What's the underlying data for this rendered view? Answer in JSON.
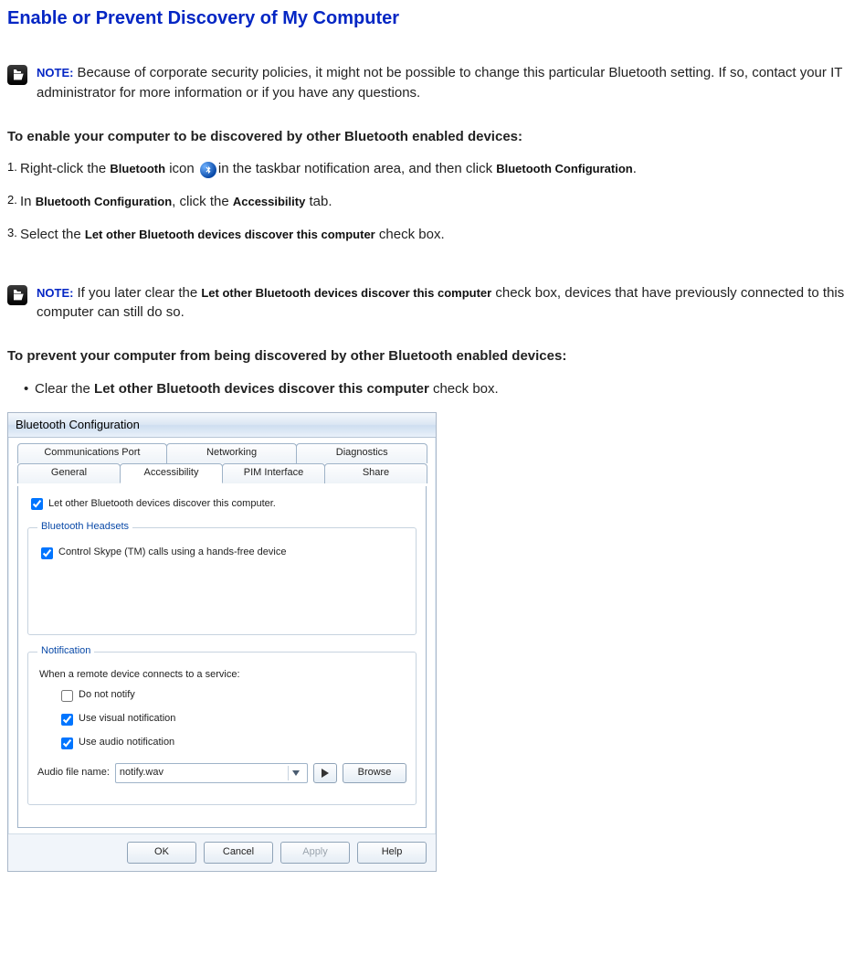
{
  "title": "Enable or Prevent Discovery of My Computer",
  "notes": {
    "label": "NOTE:",
    "note1": "Because of corporate security policies, it might not be possible to change this particular Bluetooth setting. If so, contact your IT administrator for more information or if you have any questions.",
    "note2_pre": "If you later clear the ",
    "note2_mid": "Let other Bluetooth devices discover this computer",
    "note2_post": " check box, devices that have previously connected to this computer can still do so."
  },
  "headings": {
    "enable": "To enable your computer to be discovered by other Bluetooth enabled devices:",
    "prevent": "To prevent your computer from being discovered by other Bluetooth enabled devices:"
  },
  "steps": {
    "s1_num": "1.",
    "s1_a": "Right-click the ",
    "s1_bt": "Bluetooth",
    "s1_b": " icon ",
    "s1_c": "in the taskbar notification area, and then click ",
    "s1_conf": "Bluetooth Configuration",
    "s1_d": ".",
    "s2_num": "2.",
    "s2_a": "In ",
    "s2_conf": "Bluetooth Configuration",
    "s2_b": ", click the ",
    "s2_acc": "Accessibility",
    "s2_c": " tab.",
    "s3_num": "3.",
    "s3_a": "Select the ",
    "s3_opt": "Let other Bluetooth devices discover this computer",
    "s3_b": " check box."
  },
  "bullet": {
    "a": "Clear the ",
    "b": "Let other Bluetooth devices discover this computer",
    "c": " check box."
  },
  "dialog": {
    "title": "Bluetooth Configuration",
    "tabs_back": [
      "Communications Port",
      "Networking",
      "Diagnostics"
    ],
    "tabs_front": [
      "General",
      "Accessibility",
      "PIM Interface",
      "Share"
    ],
    "chk_discover": "Let other Bluetooth devices discover this computer.",
    "grp_headsets": "Bluetooth Headsets",
    "chk_skype": "Control Skype (TM) calls using a hands-free device",
    "grp_notify": "Notification",
    "notify_text": "When a remote device connects to a service:",
    "chk_dnn": "Do not notify",
    "chk_visual": "Use visual notification",
    "chk_audio": "Use audio notification",
    "audio_label": "Audio file name:",
    "audio_value": "notify.wav",
    "browse": "Browse",
    "buttons": {
      "ok": "OK",
      "cancel": "Cancel",
      "apply": "Apply",
      "help": "Help"
    }
  }
}
